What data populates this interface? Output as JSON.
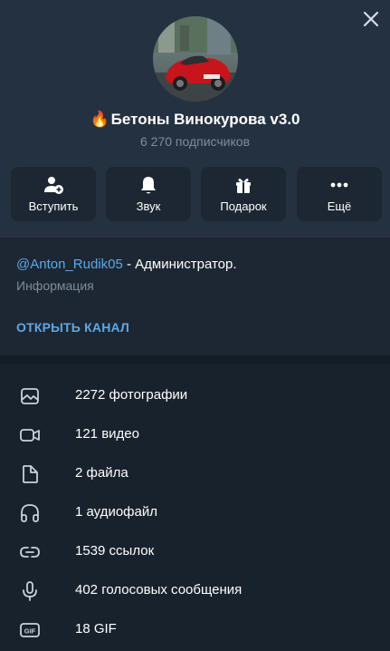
{
  "channel": {
    "title": "Бетоны Винокурова v3.0",
    "title_emoji": "🔥",
    "subscribers": "6 270 подписчиков"
  },
  "actions": [
    {
      "label": "Вступить",
      "icon": "add-user-icon"
    },
    {
      "label": "Звук",
      "icon": "bell-icon"
    },
    {
      "label": "Подарок",
      "icon": "gift-icon"
    },
    {
      "label": "Ещё",
      "icon": "more-icon"
    }
  ],
  "info": {
    "mention": "@Anton_Rudik05",
    "description_rest": " - Администратор.",
    "caption": "Информация",
    "open_channel": "ОТКРЫТЬ КАНАЛ"
  },
  "media": [
    {
      "label": "2272 фотографии",
      "icon": "photo-icon"
    },
    {
      "label": "121 видео",
      "icon": "video-icon"
    },
    {
      "label": "2 файла",
      "icon": "file-icon"
    },
    {
      "label": "1 аудиофайл",
      "icon": "headphones-icon"
    },
    {
      "label": "1539 ссылок",
      "icon": "link-icon"
    },
    {
      "label": "402 голосовых сообщения",
      "icon": "microphone-icon"
    },
    {
      "label": "18 GIF",
      "icon": "gif-icon"
    }
  ],
  "colors": {
    "header_bg": "#243140",
    "panel_bg": "#18222d",
    "accent": "#5ea9e4",
    "muted_text": "#7f8c99"
  }
}
